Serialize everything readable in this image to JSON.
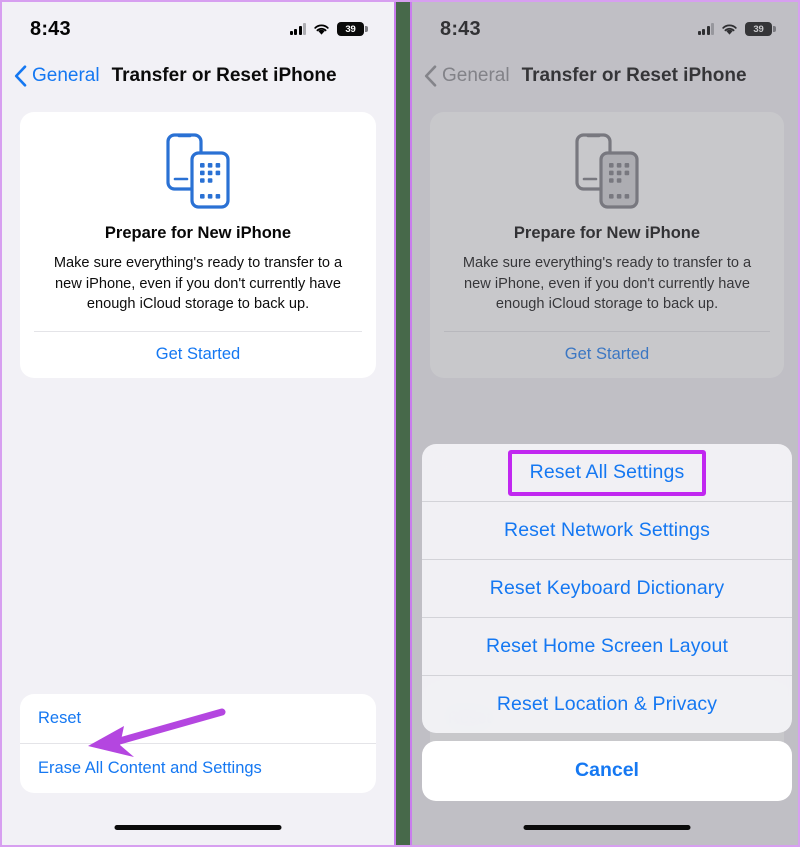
{
  "meta": {
    "accent_blue": "#1578f2",
    "annotation_purple": "#c127f0",
    "divider_green": "#47694a",
    "ios_bg": "#f2f1f6"
  },
  "status_bar": {
    "time": "8:43",
    "battery_percent": "39",
    "signal_icon": "cellular-signal-icon",
    "wifi_icon": "wifi-icon",
    "battery_icon": "battery-icon"
  },
  "nav": {
    "back_icon": "chevron-left-icon",
    "back_label": "General",
    "title": "Transfer or Reset iPhone"
  },
  "prepare_card": {
    "icon": "two-phones-transfer-icon",
    "title": "Prepare for New iPhone",
    "description": "Make sure everything's ready to transfer to a new iPhone, even if you don't currently have enough iCloud storage to back up.",
    "action_label": "Get Started"
  },
  "reset_list": {
    "items": [
      {
        "label": "Reset"
      },
      {
        "label": "Erase All Content and Settings"
      }
    ]
  },
  "action_sheet": {
    "items": [
      {
        "label": "Reset All Settings",
        "highlighted": true
      },
      {
        "label": "Reset Network Settings",
        "highlighted": false
      },
      {
        "label": "Reset Keyboard Dictionary",
        "highlighted": false
      },
      {
        "label": "Reset Home Screen Layout",
        "highlighted": false
      },
      {
        "label": "Reset Location & Privacy",
        "highlighted": false
      }
    ],
    "cancel_label": "Cancel"
  },
  "annotation": {
    "arrow_icon": "arrow-pointing-left-icon",
    "arrow_target": "Reset",
    "highlight_icon": "highlight-rectangle-icon",
    "highlight_target": "Reset All Settings"
  }
}
